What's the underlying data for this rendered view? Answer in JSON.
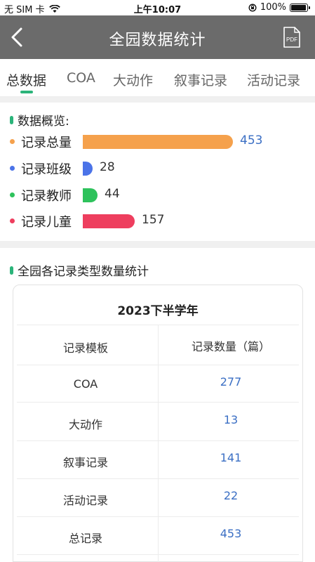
{
  "status_bar": {
    "carrier": "无 SIM 卡",
    "time": "上午10:07",
    "battery_level": "100%",
    "battery_fraction": 1.0
  },
  "header": {
    "title": "全园数据统计",
    "pdf_label": "PDF"
  },
  "tabs": [
    {
      "label": "总数据",
      "active": true
    },
    {
      "label": "COA",
      "active": false
    },
    {
      "label": "大动作",
      "active": false
    },
    {
      "label": "叙事记录",
      "active": false
    },
    {
      "label": "活动记录",
      "active": false
    }
  ],
  "overview": {
    "title": "数据概览:",
    "max_value": 453,
    "items": [
      {
        "label": "记录总量",
        "value": 453,
        "color": "#f5a14c"
      },
      {
        "label": "记录班级",
        "value": 28,
        "color": "#4b73e8"
      },
      {
        "label": "记录教师",
        "value": 44,
        "color": "#2ec25c"
      },
      {
        "label": "记录儿童",
        "value": 157,
        "color": "#ee3e5e"
      }
    ]
  },
  "stats": {
    "title": "全园各记录类型数量统计",
    "table_title": "2023下半学年",
    "columns": [
      "记录模板",
      "记录数量（篇）"
    ],
    "rows": [
      {
        "template": "COA",
        "count": "277"
      },
      {
        "template": "大动作",
        "count": "13"
      },
      {
        "template": "叙事记录",
        "count": "141"
      },
      {
        "template": "活动记录",
        "count": "22"
      },
      {
        "template": "总记录",
        "count": "453"
      }
    ]
  }
}
